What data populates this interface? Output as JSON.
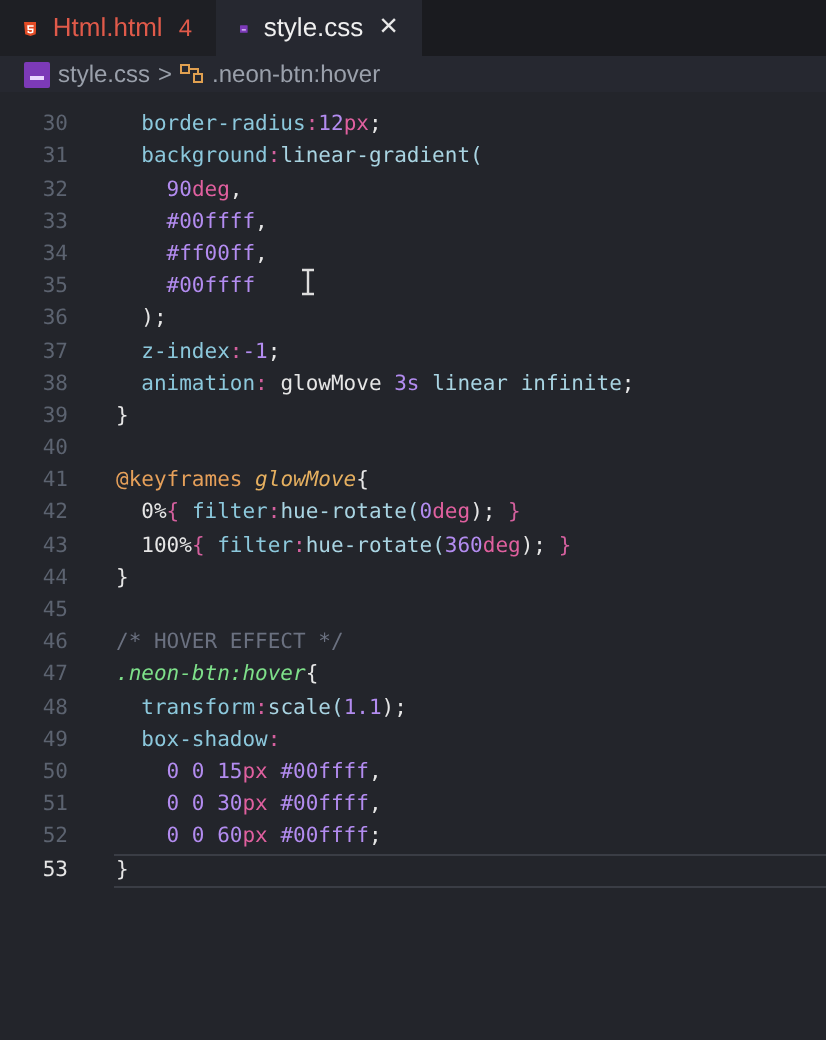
{
  "tabs": [
    {
      "label": "Html.html",
      "badge": "4",
      "kind": "html",
      "selected": false,
      "has_errors": true
    },
    {
      "label": "style.css",
      "kind": "css",
      "selected": true,
      "has_errors": false,
      "close": "×"
    }
  ],
  "breadcrumb": {
    "file": "style.css",
    "separator": ">",
    "symbol": ".neon-btn:hover"
  },
  "lines": [
    {
      "number": "30",
      "current": false,
      "tokens": [
        {
          "text": "  border-radius",
          "kind": "prop"
        },
        {
          "text": ":",
          "kind": "colon"
        },
        {
          "text": "12",
          "kind": "num"
        },
        {
          "text": "px",
          "kind": "unit"
        },
        {
          "text": ";",
          "kind": "plain"
        }
      ]
    },
    {
      "number": "31",
      "current": false,
      "tokens": [
        {
          "text": "  background",
          "kind": "prop"
        },
        {
          "text": ":",
          "kind": "colon"
        },
        {
          "text": "linear-gradient(",
          "kind": "func"
        }
      ]
    },
    {
      "number": "32",
      "current": false,
      "tokens": [
        {
          "text": "    90",
          "kind": "num"
        },
        {
          "text": "deg",
          "kind": "unit"
        },
        {
          "text": ",",
          "kind": "plain"
        }
      ]
    },
    {
      "number": "33",
      "current": false,
      "tokens": [
        {
          "text": "    #00ffff",
          "kind": "num"
        },
        {
          "text": ",",
          "kind": "plain"
        }
      ]
    },
    {
      "number": "34",
      "current": false,
      "tokens": [
        {
          "text": "    #ff00ff",
          "kind": "num"
        },
        {
          "text": ",",
          "kind": "plain"
        }
      ]
    },
    {
      "number": "35",
      "current": false,
      "tokens": [
        {
          "text": "    #00ffff",
          "kind": "num"
        }
      ]
    },
    {
      "number": "36",
      "current": false,
      "tokens": [
        {
          "text": "  );",
          "kind": "plain"
        }
      ]
    },
    {
      "number": "37",
      "current": false,
      "tokens": [
        {
          "text": "  z-index",
          "kind": "prop"
        },
        {
          "text": ":",
          "kind": "colon"
        },
        {
          "text": "-1",
          "kind": "num"
        },
        {
          "text": ";",
          "kind": "plain"
        }
      ]
    },
    {
      "number": "38",
      "current": false,
      "tokens": [
        {
          "text": "  animation",
          "kind": "prop"
        },
        {
          "text": ": ",
          "kind": "colon"
        },
        {
          "text": "glowMove ",
          "kind": "plain"
        },
        {
          "text": "3s ",
          "kind": "num"
        },
        {
          "text": "linear infinite",
          "kind": "func"
        },
        {
          "text": ";",
          "kind": "plain"
        }
      ]
    },
    {
      "number": "39",
      "current": false,
      "tokens": [
        {
          "text": "}",
          "kind": "plain"
        }
      ]
    },
    {
      "number": "40",
      "current": false
    },
    {
      "number": "41",
      "current": false,
      "tokens": [
        {
          "text": "@keyframes ",
          "kind": "keyword"
        },
        {
          "text": "glowMove",
          "kind": "name"
        },
        {
          "text": "{",
          "kind": "plain"
        }
      ]
    },
    {
      "number": "42",
      "current": false,
      "tokens": [
        {
          "text": "  0%",
          "kind": "plain"
        },
        {
          "text": "{ ",
          "kind": "colon"
        },
        {
          "text": "filter",
          "kind": "prop"
        },
        {
          "text": ":",
          "kind": "colon"
        },
        {
          "text": "hue-rotate(",
          "kind": "func"
        },
        {
          "text": "0",
          "kind": "num"
        },
        {
          "text": "deg",
          "kind": "unit"
        },
        {
          "text": "); ",
          "kind": "plain"
        },
        {
          "text": "}",
          "kind": "colon"
        }
      ]
    },
    {
      "number": "43",
      "current": false,
      "tokens": [
        {
          "text": "  100%",
          "kind": "plain"
        },
        {
          "text": "{ ",
          "kind": "colon"
        },
        {
          "text": "filter",
          "kind": "prop"
        },
        {
          "text": ":",
          "kind": "colon"
        },
        {
          "text": "hue-rotate(",
          "kind": "func"
        },
        {
          "text": "360",
          "kind": "num"
        },
        {
          "text": "deg",
          "kind": "unit"
        },
        {
          "text": "); ",
          "kind": "plain"
        },
        {
          "text": "}",
          "kind": "colon"
        }
      ]
    },
    {
      "number": "44",
      "current": false,
      "tokens": [
        {
          "text": "}",
          "kind": "plain"
        }
      ]
    },
    {
      "number": "45",
      "current": false
    },
    {
      "number": "46",
      "current": false,
      "tokens": [
        {
          "text": "/* HOVER EFFECT */",
          "kind": "comment"
        }
      ]
    },
    {
      "number": "47",
      "current": false,
      "tokens": [
        {
          "text": ".neon-btn:hover",
          "kind": "selector"
        },
        {
          "text": "{",
          "kind": "plain"
        }
      ]
    },
    {
      "number": "48",
      "current": false,
      "tokens": [
        {
          "text": "  transform",
          "kind": "prop"
        },
        {
          "text": ":",
          "kind": "colon"
        },
        {
          "text": "scale(",
          "kind": "func"
        },
        {
          "text": "1.1",
          "kind": "num"
        },
        {
          "text": ");",
          "kind": "plain"
        }
      ]
    },
    {
      "number": "49",
      "current": false,
      "tokens": [
        {
          "text": "  box-shadow",
          "kind": "prop"
        },
        {
          "text": ":",
          "kind": "colon"
        }
      ]
    },
    {
      "number": "50",
      "current": false,
      "tokens": [
        {
          "text": "    0 0 15",
          "kind": "num"
        },
        {
          "text": "px ",
          "kind": "unit"
        },
        {
          "text": "#00ffff",
          "kind": "num"
        },
        {
          "text": ",",
          "kind": "plain"
        }
      ]
    },
    {
      "number": "51",
      "current": false,
      "tokens": [
        {
          "text": "    0 0 30",
          "kind": "num"
        },
        {
          "text": "px ",
          "kind": "unit"
        },
        {
          "text": "#00ffff",
          "kind": "num"
        },
        {
          "text": ",",
          "kind": "plain"
        }
      ]
    },
    {
      "number": "52",
      "current": false,
      "tokens": [
        {
          "text": "    0 0 60",
          "kind": "num"
        },
        {
          "text": "px ",
          "kind": "unit"
        },
        {
          "text": "#00ffff",
          "kind": "num"
        },
        {
          "text": ";",
          "kind": "plain"
        }
      ]
    },
    {
      "number": "53",
      "current": true,
      "tokens": [
        {
          "text": "}",
          "kind": "plain"
        }
      ]
    }
  ]
}
